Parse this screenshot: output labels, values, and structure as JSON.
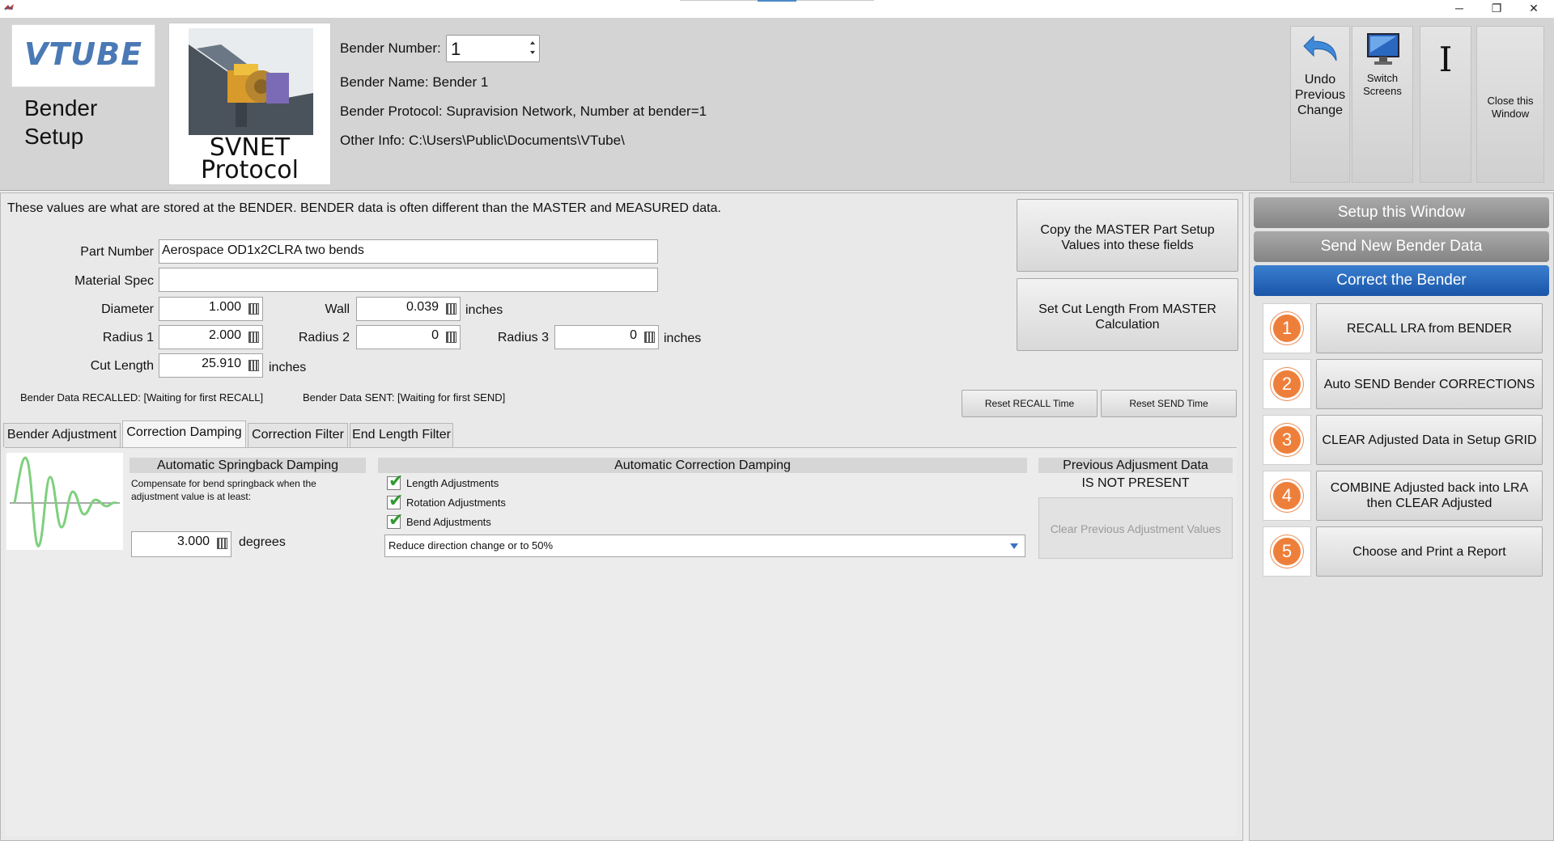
{
  "window": {
    "minimize_glyph": "─",
    "restore_glyph": "❐",
    "close_glyph": "✕"
  },
  "header": {
    "logo_text": "VTUBE",
    "app_title": "Bender Setup",
    "protocol_label": "SVNET Protocol",
    "bender_number_label": "Bender Number:",
    "bender_number_value": "1",
    "bender_name": "Bender Name: Bender 1",
    "bender_protocol": "Bender Protocol: Supravision Network, Number at bender=1",
    "other_info": "Other Info: C:\\Users\\Public\\Documents\\VTube\\",
    "undo_label": "Undo Previous Change",
    "switch_label": "Switch Screens",
    "cursor_glyph": "I",
    "close_label": "Close this Window"
  },
  "main": {
    "info_line": "These values are what are stored at the BENDER.  BENDER data is often different than the MASTER and MEASURED data.",
    "part_number_label": "Part Number",
    "part_number_value": "Aerospace OD1x2CLRA two bends",
    "material_spec_label": "Material Spec",
    "material_spec_value": "",
    "diameter_label": "Diameter",
    "diameter_value": "1.000",
    "wall_label": "Wall",
    "wall_value": "0.039",
    "radius1_label": "Radius 1",
    "radius1_value": "2.000",
    "radius2_label": "Radius 2",
    "radius2_value": "0",
    "radius3_label": "Radius 3",
    "radius3_value": "0",
    "cut_length_label": "Cut Length",
    "cut_length_value": "25.910",
    "unit_inches": "inches",
    "copy_master_button": "Copy the MASTER Part Setup Values into these fields",
    "set_cut_button": "Set Cut Length From MASTER Calculation",
    "recalled_status": "Bender Data RECALLED:  [Waiting for first RECALL]",
    "sent_status": "Bender Data SENT:  [Waiting for first SEND]",
    "reset_recall_button": "Reset RECALL Time",
    "reset_send_button": "Reset SEND Time"
  },
  "tabs": [
    {
      "label": "Bender Adjustment"
    },
    {
      "label": "Correction Damping"
    },
    {
      "label": "Correction Filter"
    },
    {
      "label": "End Length Filter"
    }
  ],
  "damping": {
    "springback_header": "Automatic Springback Damping",
    "springback_desc": "Compensate for bend springback when the adjustment value is at least:",
    "springback_value": "3.000",
    "springback_unit": "degrees",
    "correction_header": "Automatic Correction Damping",
    "checks": [
      {
        "label": "Length Adjustments",
        "checked": true,
        "mark": "✔"
      },
      {
        "label": "Rotation Adjustments",
        "checked": true,
        "mark": "✔"
      },
      {
        "label": "Bend Adjustments",
        "checked": true,
        "mark": "✔"
      }
    ],
    "mode_selected": "Reduce direction change or to 50%",
    "prev_header": "Previous Adjusment Data",
    "prev_status": "IS NOT PRESENT",
    "clear_prev_button": "Clear Previous Adjustment Values"
  },
  "right_panel": {
    "tabs": [
      {
        "label": "Setup this Window"
      },
      {
        "label": "Send New Bender Data"
      },
      {
        "label": "Correct the Bender"
      }
    ],
    "steps": [
      {
        "num": "1",
        "label": "RECALL LRA from BENDER"
      },
      {
        "num": "2",
        "label": "Auto SEND Bender CORRECTIONS"
      },
      {
        "num": "3",
        "label": "CLEAR Adjusted Data in Setup GRID"
      },
      {
        "num": "4",
        "label": "COMBINE Adjusted back into LRA then CLEAR Adjusted"
      },
      {
        "num": "5",
        "label": "Choose and Print a Report"
      }
    ]
  },
  "colors": {
    "accent_blue": "#1a55a8",
    "step_orange": "#ee7f3b",
    "check_green": "#2f9a2f",
    "graph_green": "#7ed07e"
  }
}
